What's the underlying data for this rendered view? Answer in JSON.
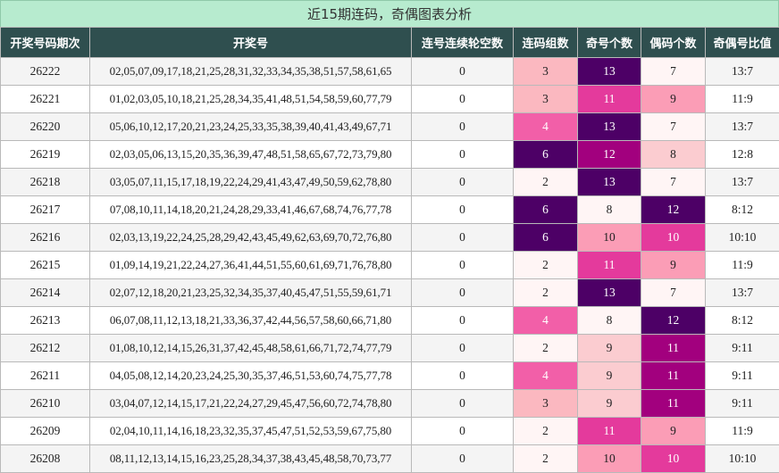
{
  "title": "近15期连码，奇偶图表分析",
  "colors": {
    "header_bg": "#2f4f4f",
    "title_bg": "#b7ebcf",
    "scale": {
      "2": "#fff5f5",
      "3": "#fbb8c0",
      "4": "#f25fa8",
      "6": "#4d0066"
    },
    "odd_scale": {
      "8": "#fff5f5",
      "9": "#fbccd0",
      "10": "#fb9db6",
      "11": "#e43a9c",
      "12": "#a2007e",
      "13": "#4d0066"
    },
    "even_scale": {
      "7": "#fff5f5",
      "8": "#fbccd0",
      "9": "#fb9db6",
      "10": "#e43a9c",
      "11": "#a2007e",
      "12": "#4d0066"
    }
  },
  "chart_data": {
    "type": "table",
    "title": "近15期连码，奇偶图表分析",
    "columns": [
      "开奖号码期次",
      "开奖号",
      "连号连续轮空数",
      "连码组数",
      "奇号个数",
      "偶码个数",
      "奇偶号比值"
    ],
    "rows": [
      [
        "26222",
        "02,05,07,09,17,18,21,25,28,31,32,33,34,35,38,51,57,58,61,65",
        "0",
        "3",
        "13",
        "7",
        "13:7"
      ],
      [
        "26221",
        "01,02,03,05,10,18,21,25,28,34,35,41,48,51,54,58,59,60,77,79",
        "0",
        "3",
        "11",
        "9",
        "11:9"
      ],
      [
        "26220",
        "05,06,10,12,17,20,21,23,24,25,33,35,38,39,40,41,43,49,67,71",
        "0",
        "4",
        "13",
        "7",
        "13:7"
      ],
      [
        "26219",
        "02,03,05,06,13,15,20,35,36,39,47,48,51,58,65,67,72,73,79,80",
        "0",
        "6",
        "12",
        "8",
        "12:8"
      ],
      [
        "26218",
        "03,05,07,11,15,17,18,19,22,24,29,41,43,47,49,50,59,62,78,80",
        "0",
        "2",
        "13",
        "7",
        "13:7"
      ],
      [
        "26217",
        "07,08,10,11,14,18,20,21,24,28,29,33,41,46,67,68,74,76,77,78",
        "0",
        "6",
        "8",
        "12",
        "8:12"
      ],
      [
        "26216",
        "02,03,13,19,22,24,25,28,29,42,43,45,49,62,63,69,70,72,76,80",
        "0",
        "6",
        "10",
        "10",
        "10:10"
      ],
      [
        "26215",
        "01,09,14,19,21,22,24,27,36,41,44,51,55,60,61,69,71,76,78,80",
        "0",
        "2",
        "11",
        "9",
        "11:9"
      ],
      [
        "26214",
        "02,07,12,18,20,21,23,25,32,34,35,37,40,45,47,51,55,59,61,71",
        "0",
        "2",
        "13",
        "7",
        "13:7"
      ],
      [
        "26213",
        "06,07,08,11,12,13,18,21,33,36,37,42,44,56,57,58,60,66,71,80",
        "0",
        "4",
        "8",
        "12",
        "8:12"
      ],
      [
        "26212",
        "01,08,10,12,14,15,26,31,37,42,45,48,58,61,66,71,72,74,77,79",
        "0",
        "2",
        "9",
        "11",
        "9:11"
      ],
      [
        "26211",
        "04,05,08,12,14,20,23,24,25,30,35,37,46,51,53,60,74,75,77,78",
        "0",
        "4",
        "9",
        "11",
        "9:11"
      ],
      [
        "26210",
        "03,04,07,12,14,15,17,21,22,24,27,29,45,47,56,60,72,74,78,80",
        "0",
        "3",
        "9",
        "11",
        "9:11"
      ],
      [
        "26209",
        "02,04,10,11,14,16,18,23,32,35,37,45,47,51,52,53,59,67,75,80",
        "0",
        "2",
        "11",
        "9",
        "11:9"
      ],
      [
        "26208",
        "08,11,12,13,14,15,16,23,25,28,34,37,38,43,45,48,58,70,73,77",
        "0",
        "2",
        "10",
        "10",
        "10:10"
      ]
    ]
  }
}
